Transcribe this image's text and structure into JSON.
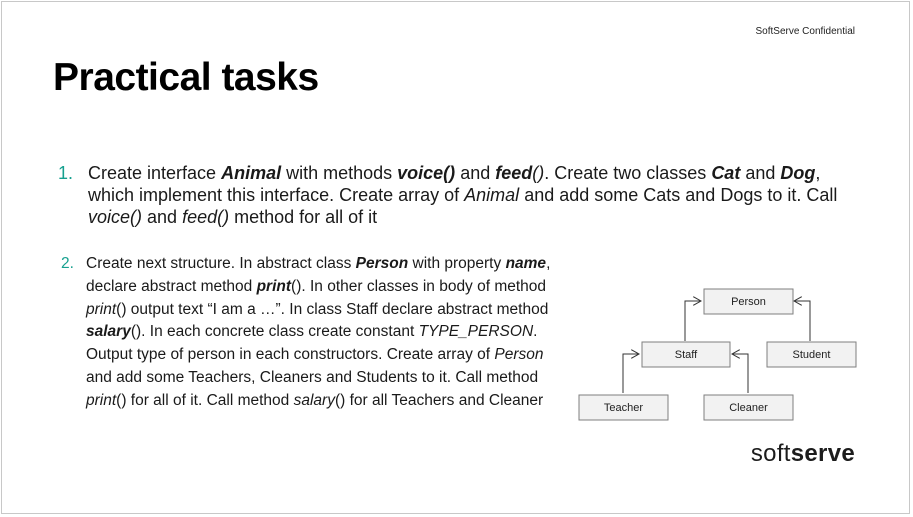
{
  "header": {
    "confidential": "SoftServe Confidential",
    "title": "Practical tasks"
  },
  "task1": {
    "number": "1.",
    "t1": "Create interface ",
    "animal": "Animal",
    "t2": " with methods ",
    "voice": "voice()",
    "t3": " and ",
    "feed": "feed",
    "feed_parens": "()",
    "t4": ". Create two classes ",
    "cat": "Cat",
    "t5": " and ",
    "dog": "Dog",
    "t6": ", which implement this interface. Create array of ",
    "animal2": "Animal",
    "t7": " and add some Cats and Dogs to it. Call ",
    "voice2": "voice()",
    "t8": " and ",
    "feed2": "feed()",
    "t9": " method for all of it"
  },
  "task2": {
    "number": "2.",
    "t1": "Create next structure. In abstract class ",
    "person": "Person",
    "t2": " with property ",
    "name": "name",
    "t3": ", declare abstract method ",
    "print": "print",
    "t4": "(). In other classes in body of method ",
    "print2": "print",
    "t5": "() output text “I am a …”. In class Staff declare abstract method ",
    "salary": "salary",
    "t6": "(). In each concrete class create constant ",
    "type_person": "TYPE_PERSON",
    "t7": ". Output type of person in each constructors. Create array of ",
    "person2": "Person",
    "t8": " and add some Teachers, Cleaners and Students to it. Call method ",
    "print3": "print",
    "t9": "() for all of it. Call method ",
    "salary2": "salary",
    "t10": "() for all Teachers and Cleaner"
  },
  "diagram": {
    "person": "Person",
    "staff": "Staff",
    "student": "Student",
    "teacher": "Teacher",
    "cleaner": "Cleaner"
  },
  "logo": {
    "soft": "soft",
    "serve": "serve"
  },
  "colors": {
    "accent": "#16a08f",
    "box_fill": "#f2f2f2",
    "box_border": "#7f7f7f"
  }
}
